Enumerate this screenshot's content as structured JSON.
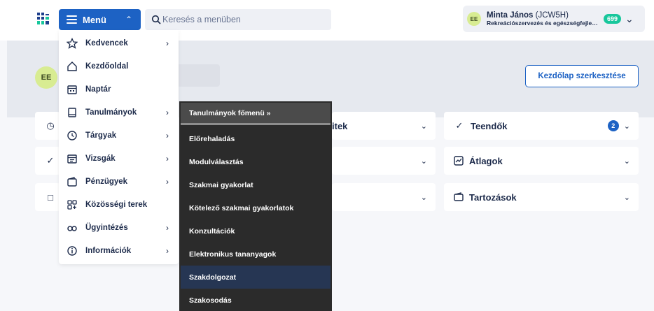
{
  "header": {
    "menu_label": "Menü",
    "search_placeholder": "Keresés a menüben",
    "user": {
      "initials": "EE",
      "name": "Minta János",
      "code": "(JCW5H)",
      "program": "Rekreációszervezés és egészségfejleszt...",
      "notification_count": "699"
    }
  },
  "welcome": {
    "initials": "EE",
    "edit_button": "Kezdőlap szerkesztése"
  },
  "widgets": [
    {
      "title": "",
      "icon": "clock-icon"
    },
    {
      "title": "",
      "icon": "check-icon"
    },
    {
      "title": "",
      "icon": "chat-icon"
    },
    {
      "title": "itek",
      "icon": ""
    },
    {
      "title": "",
      "icon": ""
    },
    {
      "title": "",
      "icon": ""
    },
    {
      "title": "Teendők",
      "icon": "todo-check-icon",
      "badge": "2"
    },
    {
      "title": "Átlagok",
      "icon": "chart-icon"
    },
    {
      "title": "Tartozások",
      "icon": "wallet-icon"
    }
  ],
  "menu": {
    "items": [
      {
        "label": "Kedvencek",
        "icon": "star-icon",
        "has_sub": true
      },
      {
        "label": "Kezdőoldal",
        "icon": "home-icon",
        "has_sub": false
      },
      {
        "label": "Naptár",
        "icon": "calendar-icon",
        "has_sub": false
      },
      {
        "label": "Tanulmányok",
        "icon": "book-icon",
        "has_sub": true
      },
      {
        "label": "Tárgyak",
        "icon": "clock-icon",
        "has_sub": true
      },
      {
        "label": "Vizsgák",
        "icon": "exam-calendar-icon",
        "has_sub": true
      },
      {
        "label": "Pénzügyek",
        "icon": "wallet-icon",
        "has_sub": true
      },
      {
        "label": "Közösségi terek",
        "icon": "community-icon",
        "has_sub": false
      },
      {
        "label": "Ügyintézés",
        "icon": "chain-icon",
        "has_sub": true
      },
      {
        "label": "Információk",
        "icon": "info-icon",
        "has_sub": true
      }
    ]
  },
  "submenu": {
    "header": "Tanulmányok főmenü »",
    "items": [
      "Előrehaladás",
      "Modulválasztás",
      "Szakmai gyakorlat",
      "Kötelező szakmai gyakorlatok",
      "Konzultációk",
      "Elektronikus tananyagok",
      "Szakdolgozat",
      "Szakosodás"
    ],
    "active_item": "Szakdolgozat"
  },
  "colors": {
    "brand": "#1d62c4",
    "badge_green": "#18c79c",
    "avatar": "#d8ec92",
    "submenu_bg": "#2b2b2b",
    "submenu_active": "#263653"
  }
}
